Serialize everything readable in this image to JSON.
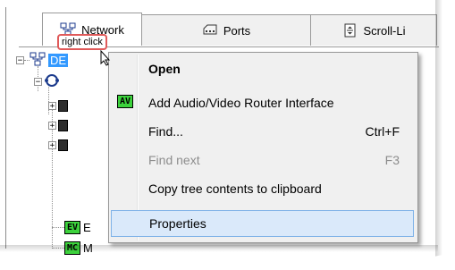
{
  "tabs": [
    {
      "label": "Network",
      "icon": "network-icon"
    },
    {
      "label": "Ports",
      "icon": "ports-icon"
    },
    {
      "label": "Scroll-Li",
      "icon": "scroll-list-icon"
    }
  ],
  "callout": {
    "text": "right click"
  },
  "tree": {
    "root_label": "DE",
    "ev_label": "E",
    "mc_label": "M",
    "badges": {
      "ev": "EV",
      "mc": "MC"
    }
  },
  "menu": {
    "items": [
      {
        "label": "Open",
        "shortcut": "",
        "bold": true
      },
      {
        "label": "Add Audio/Video Router Interface",
        "shortcut": "",
        "icon": "av-icon",
        "icon_text": "AV"
      },
      {
        "label": "Find...",
        "shortcut": "Ctrl+F"
      },
      {
        "label": "Find next",
        "shortcut": "F3",
        "disabled": true
      },
      {
        "label": "Copy tree contents to clipboard",
        "shortcut": ""
      },
      {
        "label": "Properties",
        "shortcut": "",
        "highlighted": true
      }
    ]
  },
  "colors": {
    "selection": "#3399ff",
    "badge_green": "#3cd23c",
    "callout_border": "#e05a5a",
    "menu_hover": "#dae9fa"
  }
}
